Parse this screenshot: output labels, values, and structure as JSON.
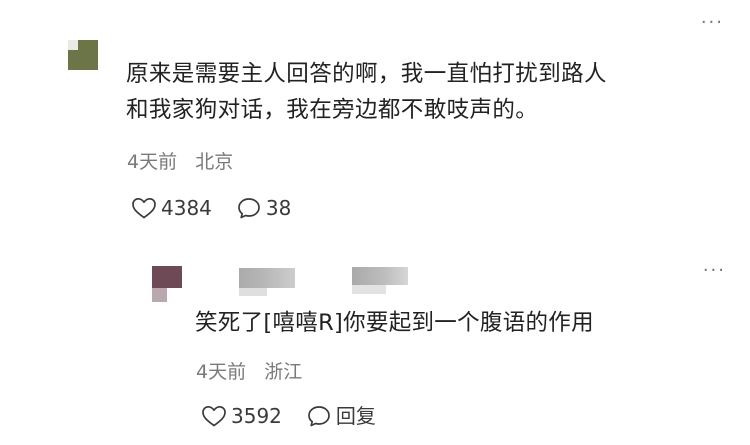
{
  "comment": {
    "more_label": "···",
    "text_line1": "原来是需要主人回答的啊，我一直怕打扰到路人",
    "text_line2": "和我家狗对话，我在旁边都不敢吱声的。",
    "time": "4天前",
    "location": "北京",
    "like_icon": "heart-outline-icon",
    "like_count": "4384",
    "comment_icon": "speech-bubble-icon",
    "comment_count": "38"
  },
  "reply": {
    "more_label": "···",
    "text": "笑死了[嘻嘻R]你要起到一个腹语的作用",
    "time": "4天前",
    "location": "浙江",
    "like_icon": "heart-outline-icon",
    "like_count": "3592",
    "reply_icon": "speech-bubble-icon",
    "reply_label": "回复"
  },
  "colors": {
    "text": "#222222",
    "meta": "#7a7a7a",
    "icon": "#3a3a3a",
    "avatar_main": "#6b7548",
    "avatar_reply": "#6d4a55"
  }
}
